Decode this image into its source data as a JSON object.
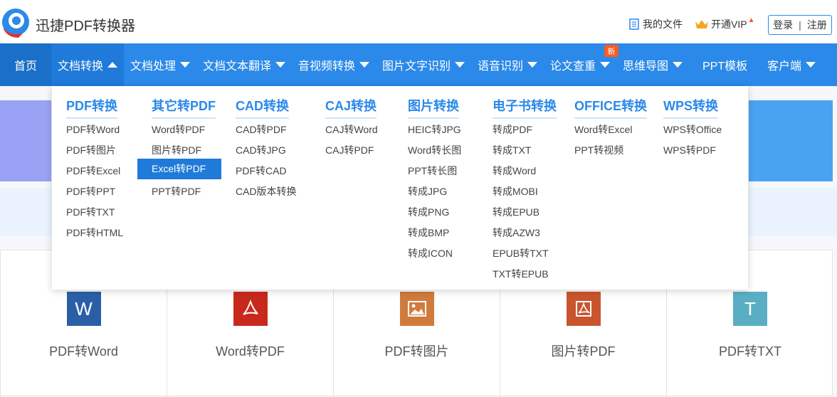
{
  "header": {
    "brand": "迅捷PDF转换器",
    "my_files": "我的文件",
    "vip": "开通VIP",
    "login": "登录",
    "register": "注册"
  },
  "nav": {
    "items": [
      "首页",
      "文档转换",
      "文档处理",
      "文档文本翻译",
      "音视频转换",
      "图片文字识别",
      "语音识别",
      "论文查重",
      "思维导图",
      "PPT模板",
      "客户端"
    ],
    "badge": "新"
  },
  "dropdown": {
    "columns": [
      {
        "title": "PDF转换",
        "items": [
          "PDF转Word",
          "PDF转图片",
          "PDF转Excel",
          "PDF转PPT",
          "PDF转TXT",
          "PDF转HTML"
        ]
      },
      {
        "title": "其它转PDF",
        "items": [
          "Word转PDF",
          "图片转PDF",
          "Excel转PDF",
          "PPT转PDF"
        ]
      },
      {
        "title": "CAD转换",
        "items": [
          "CAD转PDF",
          "CAD转JPG",
          "PDF转CAD",
          "CAD版本转换"
        ]
      },
      {
        "title": "CAJ转换",
        "items": [
          "CAJ转Word",
          "CAJ转PDF"
        ]
      },
      {
        "title": "图片转换",
        "items": [
          "HEIC转JPG",
          "Word转长图",
          "PPT转长图",
          "转成JPG",
          "转成PNG",
          "转成BMP",
          "转成ICON"
        ]
      },
      {
        "title": "电子书转换",
        "items": [
          "转成PDF",
          "转成TXT",
          "转成Word",
          "转成MOBI",
          "转成EPUB",
          "转成AZW3",
          "EPUB转TXT",
          "TXT转EPUB"
        ]
      },
      {
        "title": "OFFICE转换",
        "items": [
          "Word转Excel",
          "PPT转视频"
        ]
      },
      {
        "title": "WPS转换",
        "items": [
          "WPS转Office",
          "WPS转PDF"
        ]
      }
    ]
  },
  "cards": [
    {
      "label": "PDF转Word",
      "icon": "word-icon",
      "glyph": "W",
      "color": "#2a5fa8"
    },
    {
      "label": "Word转PDF",
      "icon": "pdf-icon",
      "glyph": "",
      "color": "#c9291c"
    },
    {
      "label": "PDF转图片",
      "icon": "image-icon",
      "glyph": "",
      "color": "#d07b3c"
    },
    {
      "label": "图片转PDF",
      "icon": "pdf-icon",
      "glyph": "",
      "color": "#c9552f"
    },
    {
      "label": "PDF转TXT",
      "icon": "txt-icon",
      "glyph": "T",
      "color": "#5aaec4"
    }
  ],
  "colors": {
    "nav": "#2b89e9",
    "accent": "#1f7ad9",
    "badge": "#ff5a1f"
  }
}
